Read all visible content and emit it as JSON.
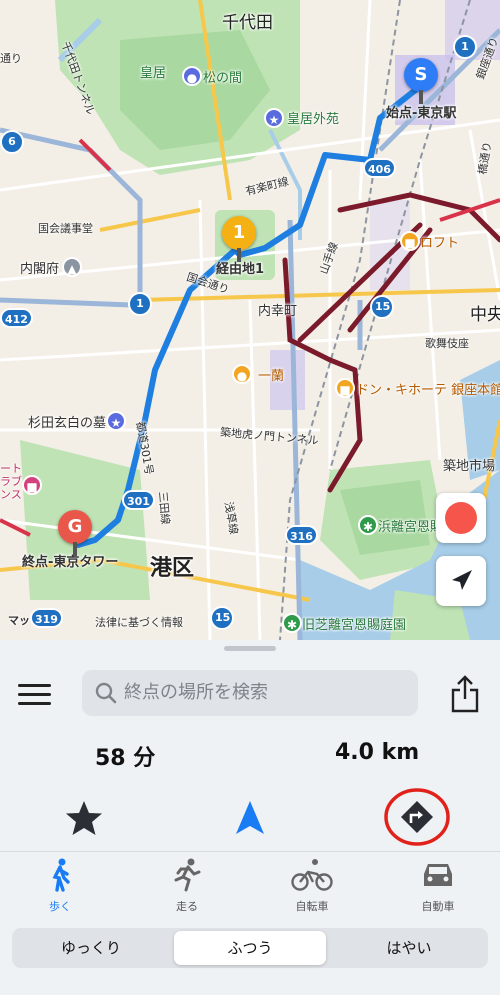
{
  "map": {
    "labels": {
      "chiyoda": "千代田",
      "kokyo": "皇居",
      "matsunoma": "松の間",
      "kokyogaien": "皇居外苑",
      "start_label": "始点-東京駅",
      "waypoint_label": "経由地1",
      "end_label": "終点-東京タワー",
      "yurakucho": "有楽町線",
      "loft": "ロフト",
      "kokkai_jigyodo": "国会議事堂",
      "naikakufu": "内閣府",
      "kokkai_dori": "国会通り",
      "uchisaiwaicho": "内幸町",
      "yamanote": "山手線",
      "naka": "中央",
      "kabukiza": "歌舞伎座",
      "ichiran": "一蘭",
      "donki": "ドン・キホーテ 銀座本館",
      "sugita": "杉田玄白の墓",
      "toranomon_tunnel": "築地虎ノ門トンネル",
      "tsukiji_market": "築地市場",
      "toei_route": "都道301号",
      "mita_line": "三田線",
      "asakusa_line": "浅草線",
      "hamarikyu": "浜離宮恩賜",
      "kyushiba": "旧芝離宮恩賜庭園",
      "minato": "港区",
      "legal": "法律に基づく情報",
      "maps_brand": "マップ",
      "hotel_frag": "ート\nラブ\nンス",
      "tori": "通り",
      "chiyoda_tunnel": "千代田トンネル",
      "hashi": "橋通り",
      "ginza_dori": "銀座通り"
    },
    "shields": {
      "r1_top": "1",
      "r406": "406",
      "r412": "412",
      "r1_mid": "1",
      "r15_a": "15",
      "r301": "301",
      "r316": "316",
      "r319": "319",
      "r15_b": "15",
      "r6": "6"
    },
    "pins": {
      "start": "S",
      "waypoint": "1",
      "end": "G"
    },
    "colors": {
      "route": "#1f7fe0",
      "start_pin": "#2f7df6",
      "waypoint_pin": "#f5b014",
      "end_pin": "#e8574a",
      "record": "#f5554a"
    }
  },
  "sheet": {
    "search_placeholder": "終点の場所を検索",
    "duration": "58 分",
    "distance": "4.0 km",
    "tabs": [
      {
        "label": "歩く",
        "icon": "walk-icon",
        "active": true
      },
      {
        "label": "走る",
        "icon": "run-icon",
        "active": false
      },
      {
        "label": "自転車",
        "icon": "bicycle-icon",
        "active": false
      },
      {
        "label": "自動車",
        "icon": "car-icon",
        "active": false
      }
    ],
    "speed_options": [
      "ゆっくり",
      "ふつう",
      "はやい"
    ],
    "speed_selected": "ふつう",
    "accent": "#1a7cf5"
  }
}
